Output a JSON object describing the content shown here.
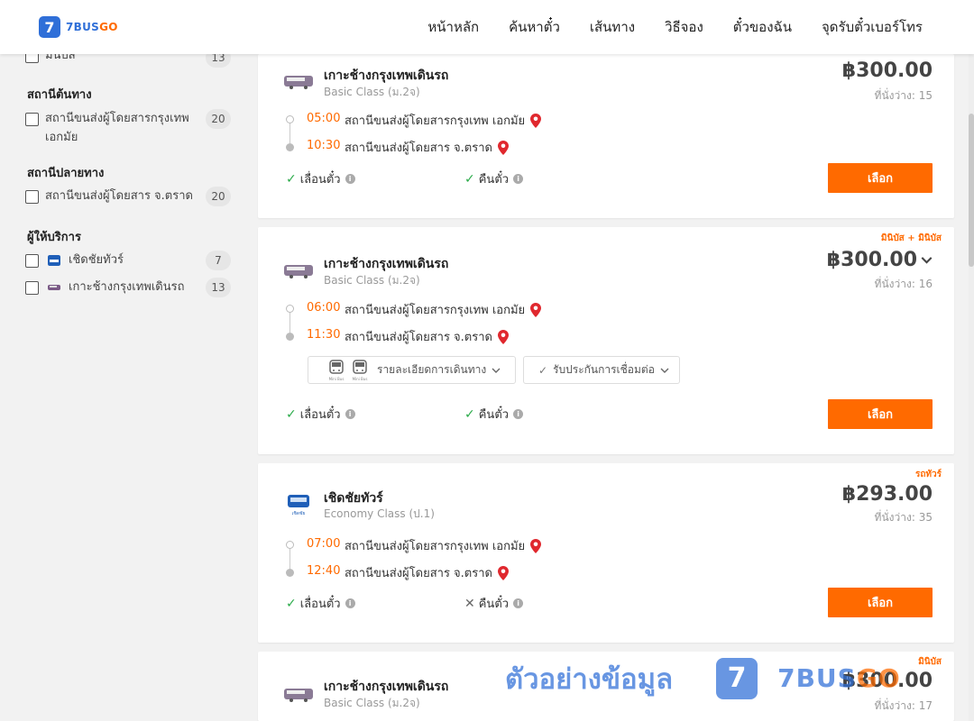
{
  "header": {
    "logo_digit": "7",
    "logo_text_a": "7BUS",
    "logo_text_b": "GO",
    "nav": [
      "หน้าหลัก",
      "ค้นหาตั๋ว",
      "เส้นทาง",
      "วิธีจอง",
      "ตั๋วของฉัน",
      "จุดรับตั๋วเบอร์โทร"
    ]
  },
  "sidebar": {
    "cut_item": {
      "label": "มินิบัส",
      "count": "13"
    },
    "origin": {
      "title": "สถานีต้นทาง",
      "items": [
        {
          "label": "สถานีขนส่งผู้โดยสารกรุงเทพ เอกมัย",
          "count": "20"
        }
      ]
    },
    "destination": {
      "title": "สถานีปลายทาง",
      "items": [
        {
          "label": "สถานีขนส่งผู้โดยสาร จ.ตราด",
          "count": "20"
        }
      ]
    },
    "operators": {
      "title": "ผู้ให้บริการ",
      "items": [
        {
          "label": "เชิดชัยทัวร์",
          "count": "7"
        },
        {
          "label": "เกาะช้างกรุงเทพเดินรถ",
          "count": "13"
        }
      ]
    }
  },
  "common": {
    "reschedule": "เลื่อนตั๋ว",
    "refund": "คืนตั๋ว",
    "select": "เลือก",
    "seats_prefix": "ที่นั่งว่าง: ",
    "route_details": "รายละเอียดการเดินทาง",
    "transfer_guarantee": "รับประกันการเชื่อมต่อ",
    "minibus_label": "Mini Bus"
  },
  "trips": [
    {
      "operator": "เกาะช้างกรุงเทพเดินรถ",
      "class": "Basic Class (ม.2จ)",
      "price": "฿300.00",
      "seats": "15",
      "depart_time": "05:00",
      "depart_station": "สถานีขนส่งผู้โดยสารกรุงเทพ เอกมัย",
      "arrive_time": "10:30",
      "arrive_station": "สถานีขนส่งผู้โดยสาร จ.ตราด",
      "tag": "",
      "refund_ok": true
    },
    {
      "operator": "เกาะช้างกรุงเทพเดินรถ",
      "class": "Basic Class (ม.2จ)",
      "price": "฿300.00",
      "seats": "16",
      "depart_time": "06:00",
      "depart_station": "สถานีขนส่งผู้โดยสารกรุงเทพ เอกมัย",
      "arrive_time": "11:30",
      "arrive_station": "สถานีขนส่งผู้โดยสาร จ.ตราด",
      "tag": "มินิบัส + มินิบัส",
      "refund_ok": true
    },
    {
      "operator": "เชิดชัยทัวร์",
      "class": "Economy Class (ป.1)",
      "price": "฿293.00",
      "seats": "35",
      "depart_time": "07:00",
      "depart_station": "สถานีขนส่งผู้โดยสารกรุงเทพ เอกมัย",
      "arrive_time": "12:40",
      "arrive_station": "สถานีขนส่งผู้โดยสาร จ.ตราด",
      "tag": "รถทัวร์",
      "refund_ok": false
    },
    {
      "operator": "เกาะช้างกรุงเทพเดินรถ",
      "class": "Basic Class (ม.2จ)",
      "price": "฿300.00",
      "seats": "17",
      "tag": "มินิบัส"
    }
  ],
  "watermark": {
    "text": "ตัวอย่างข้อมูล",
    "brand_a": "7BUS",
    "brand_b": "GO",
    "digit": "7"
  },
  "colors": {
    "accent": "#ff6a00",
    "brand_blue": "#2f6fd8",
    "check_green": "#2bab4a"
  }
}
